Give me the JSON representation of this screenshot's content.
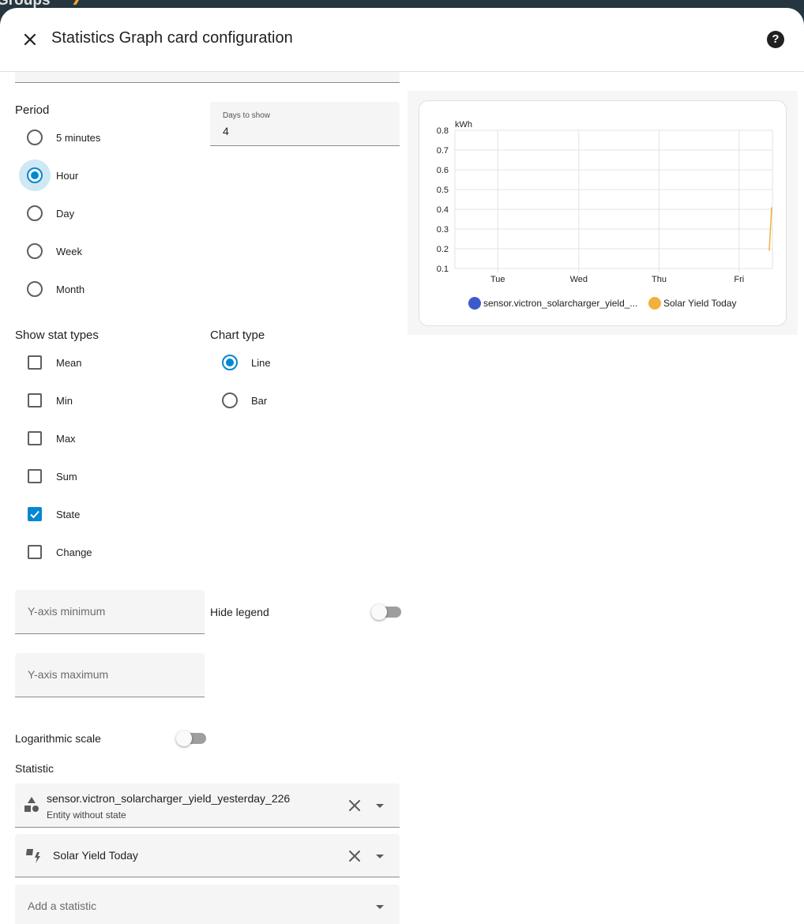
{
  "background_strip": {
    "text": "Groups"
  },
  "dialog": {
    "title": "Statistics Graph card configuration",
    "close_icon": "close-icon",
    "help_icon": "help-icon",
    "help_glyph": "?"
  },
  "period": {
    "label": "Period",
    "options": [
      "5 minutes",
      "Hour",
      "Day",
      "Week",
      "Month"
    ],
    "selected": "Hour"
  },
  "days_to_show": {
    "label": "Days to show",
    "value": "4"
  },
  "stat_types": {
    "label": "Show stat types",
    "options": [
      {
        "label": "Mean",
        "checked": false
      },
      {
        "label": "Min",
        "checked": false
      },
      {
        "label": "Max",
        "checked": false
      },
      {
        "label": "Sum",
        "checked": false
      },
      {
        "label": "State",
        "checked": true
      },
      {
        "label": "Change",
        "checked": false
      }
    ]
  },
  "chart_type": {
    "label": "Chart type",
    "options": [
      "Line",
      "Bar"
    ],
    "selected": "Line"
  },
  "y_axis_minimum": {
    "placeholder": "Y-axis minimum",
    "value": ""
  },
  "y_axis_maximum": {
    "placeholder": "Y-axis maximum",
    "value": ""
  },
  "hide_legend": {
    "label": "Hide legend",
    "on": false
  },
  "logarithmic_scale": {
    "label": "Logarithmic scale",
    "on": false
  },
  "statistic": {
    "label": "Statistic",
    "items": [
      {
        "primary": "sensor.victron_solarcharger_yield_yesterday_226",
        "secondary": "Entity without state",
        "icon": "shapes-icon"
      },
      {
        "primary": "Solar Yield Today",
        "secondary": "",
        "icon": "solar-power-icon"
      }
    ],
    "add_placeholder": "Add a statistic"
  },
  "colors": {
    "accent": "#0288d1",
    "series_1": "#3b5bcc",
    "series_2": "#f2b13c"
  },
  "chart_data": {
    "type": "line",
    "ylabel": "kWh",
    "ylim": [
      0.1,
      0.8
    ],
    "y_ticks": [
      "0.8",
      "0.7",
      "0.6",
      "0.5",
      "0.4",
      "0.3",
      "0.2",
      "0.1"
    ],
    "x_ticks": [
      "Tue",
      "Wed",
      "Thu",
      "Fri"
    ],
    "grid": true,
    "legend_position": "bottom",
    "series": [
      {
        "name": "sensor.victron_solarcharger_yield_...",
        "values": []
      },
      {
        "name": "Solar Yield Today",
        "values": [
          0.19,
          0.41
        ]
      }
    ]
  }
}
